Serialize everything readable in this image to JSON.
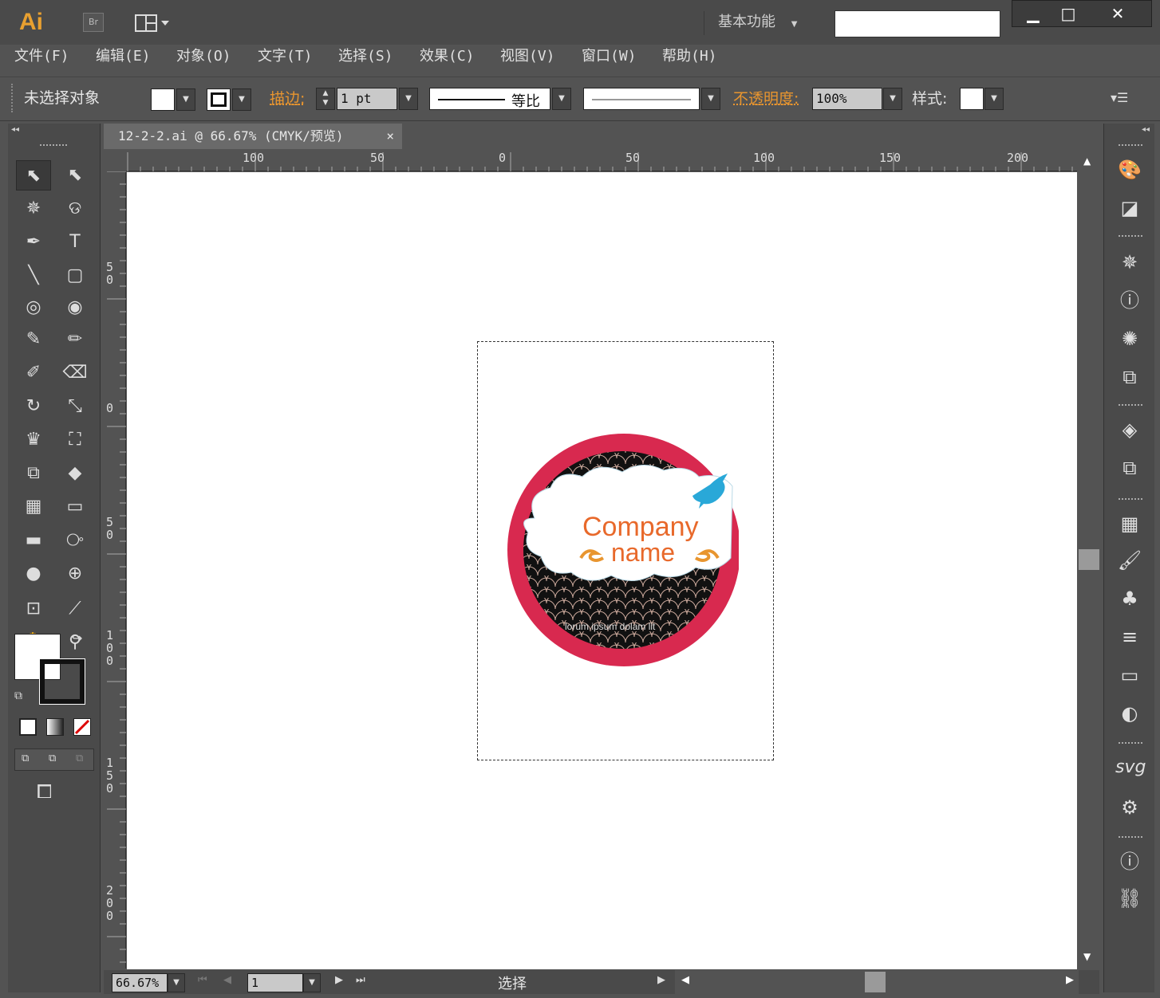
{
  "app": {
    "logo": "Ai",
    "bridge": "Br",
    "workspace": "基本功能",
    "search_value": ""
  },
  "window_controls": {
    "minimize": "▁",
    "maximize": "□",
    "close": "✕"
  },
  "menu": [
    "文件(F)",
    "编辑(E)",
    "对象(O)",
    "文字(T)",
    "选择(S)",
    "效果(C)",
    "视图(V)",
    "窗口(W)",
    "帮助(H)"
  ],
  "control": {
    "selection": "未选择对象",
    "stroke_label": "描边:",
    "stroke_value": "1 pt",
    "profile": "等比",
    "opacity_label": "不透明度:",
    "opacity_value": "100%",
    "style_label": "样式:"
  },
  "document": {
    "tab_title": "12-2-2.ai @ 66.67% (CMYK/预览)",
    "close": "×"
  },
  "rulers": {
    "horizontal": [
      "100",
      "50",
      "0",
      "50",
      "100",
      "150",
      "200"
    ],
    "vertical": [
      "50",
      "0",
      "50",
      "100",
      "150",
      "200"
    ]
  },
  "artwork": {
    "line1": "Company",
    "line2": "name",
    "tagline": "lorum ipsum dolam lit"
  },
  "status": {
    "zoom": "66.67%",
    "page": "1",
    "tool": "选择"
  },
  "colors": {
    "accent": "#e8952f",
    "logo_ring": "#d8294f",
    "text_orange": "#e8692b",
    "bird": "#29a8d8"
  }
}
